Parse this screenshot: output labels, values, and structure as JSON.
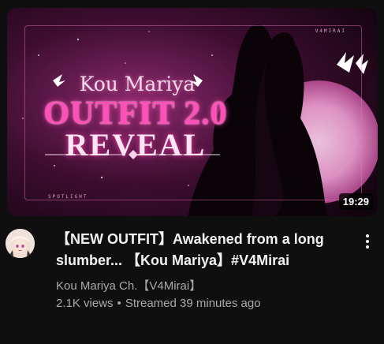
{
  "video": {
    "thumbnail": {
      "title_name": "Kou Mariya",
      "title_line1": "OUTFIT 2.0",
      "title_line2": "REVEAL",
      "tag_top": "V4MIRAI",
      "tag_bottom": "SPOTLIGHT",
      "duration": "19:29"
    },
    "title": "【NEW OUTFIT】Awakened from a long slumber... 【Kou Mariya】#V4Mirai",
    "channel": "Kou Mariya Ch.【V4Mirai】",
    "views": "2.1K views",
    "separator": "•",
    "streamed": "Streamed 39 minutes ago",
    "more_icon": "vertical-ellipsis-icon",
    "avatar_icon": "channel-avatar"
  },
  "colors": {
    "background": "#0f0f0f",
    "primary_text": "#f1f1f1",
    "secondary_text": "#aaaaaa",
    "accent_pink": "#ff4fb8"
  }
}
